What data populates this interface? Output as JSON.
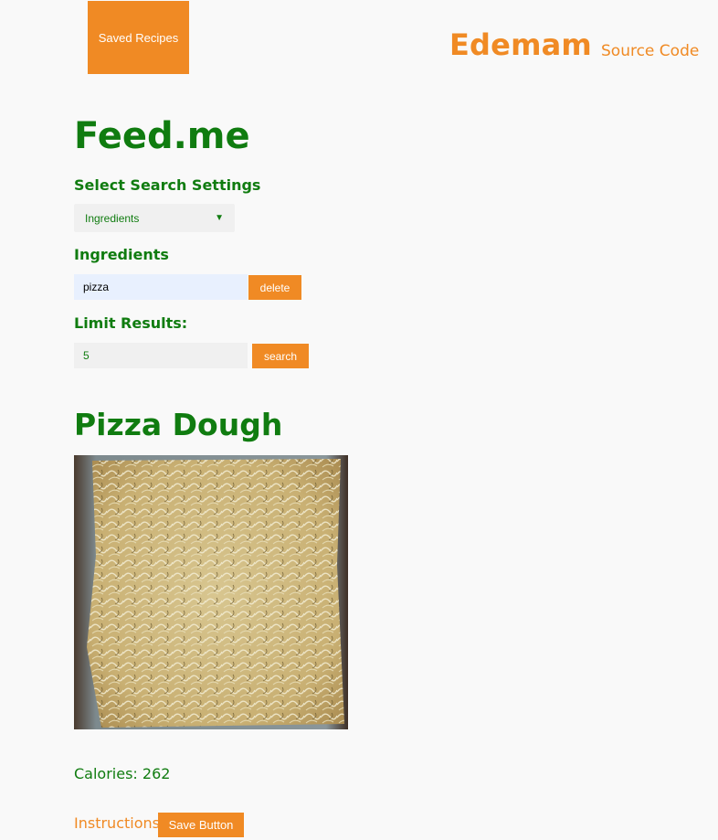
{
  "header": {
    "saved_recipes_label": "Saved Recipes",
    "brand": "Edemam",
    "source_code_label": "Source Code"
  },
  "search": {
    "app_title": "Feed.me",
    "settings_label": "Select Search Settings",
    "settings_selected": "Ingredients",
    "ingredients_label": "Ingredients",
    "ingredient_value": "pizza",
    "delete_label": "delete",
    "limit_label": "Limit Results:",
    "limit_value": "5",
    "search_label": "search"
  },
  "recipe": {
    "title": "Pizza Dough",
    "image_alt_icon": "pizza-dough-photo",
    "calories_text": "Calories: 262",
    "instructions_label": "Instructions",
    "save_label": "Save Button"
  },
  "colors": {
    "accent_orange": "#f08a24",
    "brand_green": "#107c10",
    "background": "#f9f9f9"
  }
}
